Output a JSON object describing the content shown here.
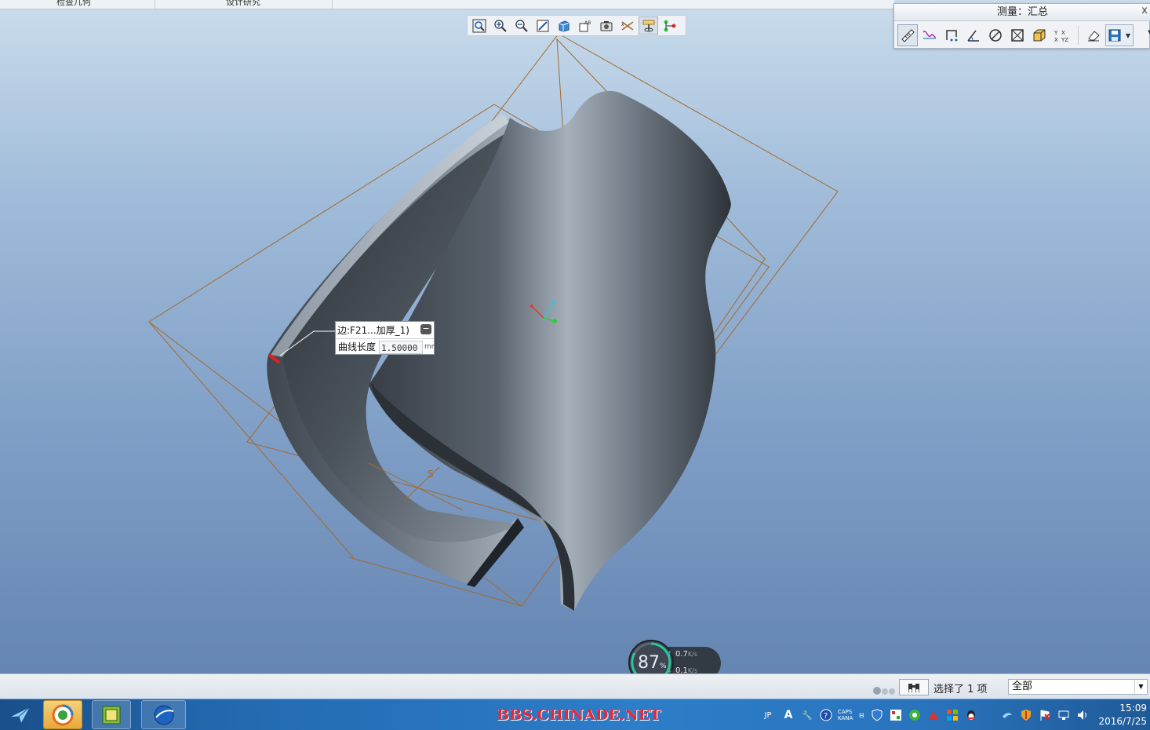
{
  "ribbon": {
    "tabs": [
      "检查几何",
      "设计研究"
    ]
  },
  "view_toolbar": {
    "buttons": [
      {
        "icon": "refit-icon",
        "active": false
      },
      {
        "icon": "zoom-in-icon",
        "active": false
      },
      {
        "icon": "zoom-out-icon",
        "active": false
      },
      {
        "icon": "repaint-icon",
        "active": false
      },
      {
        "icon": "display-style-icon",
        "active": false
      },
      {
        "icon": "saved-orientations-icon",
        "active": false
      },
      {
        "icon": "view-manager-icon",
        "active": false
      },
      {
        "icon": "datum-display-icon",
        "active": false
      },
      {
        "icon": "spin-center-icon",
        "active": true
      },
      {
        "icon": "annotation-display-icon",
        "active": false
      }
    ]
  },
  "measure_panel": {
    "title": "测量：汇总",
    "close": "x",
    "tools": [
      "length-icon",
      "curve-icon",
      "distance-icon",
      "angle-icon",
      "diameter-icon",
      "area-icon",
      "volume-icon",
      "transform-icon"
    ],
    "eraser": "eraser-icon",
    "save": "save-icon"
  },
  "callout": {
    "reference": "边:F21...加厚_1)",
    "label": "曲线长度",
    "value": "1.50000",
    "unit": "mm"
  },
  "perf": {
    "percent": "87",
    "percent_sign": "%",
    "upload": "0.7",
    "download": "0.1",
    "rate_unit": "K/s"
  },
  "status_bar": {
    "selection": "选择了 1 项",
    "filter": "全部"
  },
  "taskbar": {
    "watermark": "BBS.CHINADE.NET",
    "ime": "JP",
    "caps": "CAPS",
    "kana": "KANA",
    "time": "15:09",
    "date": "2016/7/25"
  },
  "colors": {
    "viewport_top": "#cadcec",
    "viewport_bottom": "#6585b2",
    "datum_plane": "#a36a2c",
    "part_shade": "#4a5561",
    "highlight_edge": "#e02020",
    "watermark": "#e02a3a"
  }
}
